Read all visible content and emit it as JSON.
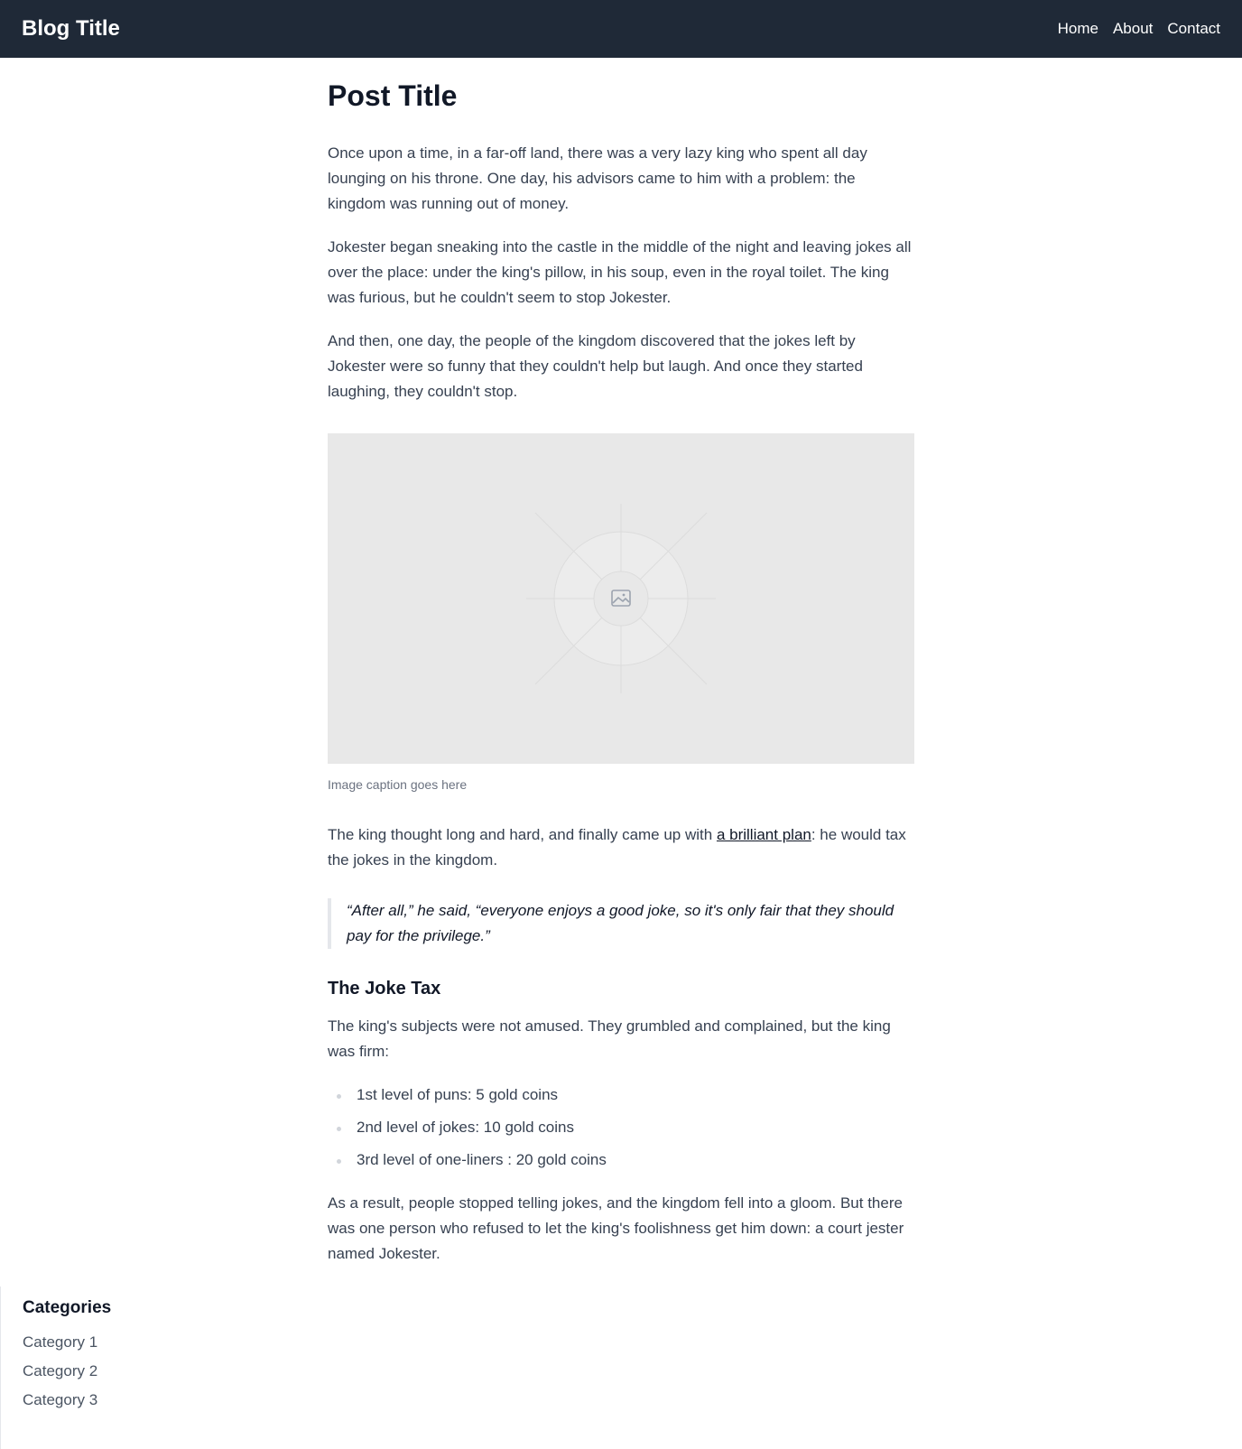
{
  "header": {
    "brand": "Blog Title",
    "nav": [
      "Home",
      "About",
      "Contact"
    ]
  },
  "post": {
    "title": "Post Title",
    "paragraphs": [
      "Once upon a time, in a far-off land, there was a very lazy king who spent all day lounging on his throne. One day, his advisors came to him with a problem: the kingdom was running out of money.",
      "Jokester began sneaking into the castle in the middle of the night and leaving jokes all over the place: under the king's pillow, in his soup, even in the royal toilet. The king was furious, but he couldn't seem to stop Jokester.",
      "And then, one day, the people of the kingdom discovered that the jokes left by Jokester were so funny that they couldn't help but laugh. And once they started laughing, they couldn't stop."
    ],
    "image": {
      "icon": "image-placeholder-icon",
      "caption": "Image caption goes here"
    },
    "plan_paragraph": {
      "before": "The king thought long and hard, and finally came up with ",
      "link": "a brilliant plan",
      "after": ": he would tax the jokes in the kingdom."
    },
    "quote": "“After all,” he said, “everyone enjoys a good joke, so it's only fair that they should pay for the privilege.”",
    "section_title": "The Joke Tax",
    "section_intro": "The king's subjects were not amused. They grumbled and complained, but the king was firm:",
    "list": [
      "1st level of puns: 5 gold coins",
      "2nd level of jokes: 10 gold coins",
      "3rd level of one-liners : 20 gold coins"
    ],
    "closing": "As a result, people stopped telling jokes, and the kingdom fell into a gloom. But there was one person who refused to let the king's foolishness get him down: a court jester named Jokester."
  },
  "sidebar": {
    "title": "Categories",
    "items": [
      "Category 1",
      "Category 2",
      "Category 3"
    ]
  },
  "colors": {
    "header_bg": "#1f2937",
    "image_placeholder_bg": "#e8e8e8",
    "text": "#374151",
    "heading": "#111827"
  }
}
